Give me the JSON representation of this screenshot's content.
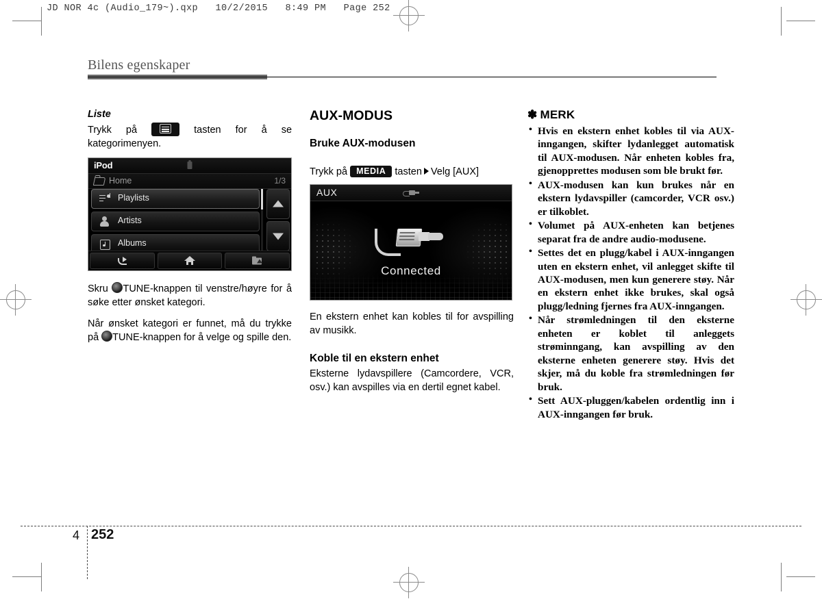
{
  "print_header": "JD NOR 4c (Audio_179~).qxp   10/2/2015   8:49 PM   Page 252",
  "page_title": "Bilens egenskaper",
  "footer": {
    "chapter": "4",
    "page": "252"
  },
  "left_column": {
    "heading": "Liste",
    "instruction_before": "Trykk på",
    "key_icon": "list-button-icon",
    "instruction_after": "tasten for å se kategorimenyen.",
    "device": {
      "title": "iPod",
      "battery_icon": "battery-icon",
      "breadcrumb": "Home",
      "page_indicator": "1/3",
      "items": [
        {
          "label": "Playlists",
          "icon": "playlist-icon",
          "selected": true
        },
        {
          "label": "Artists",
          "icon": "person-icon",
          "selected": false
        },
        {
          "label": "Albums",
          "icon": "album-icon",
          "selected": false
        }
      ],
      "scroll_up_icon": "arrow-up-icon",
      "scroll_down_icon": "arrow-down-icon",
      "bottom_buttons": [
        {
          "icon": "back-icon"
        },
        {
          "icon": "home-icon"
        },
        {
          "icon": "folder-up-icon"
        }
      ]
    },
    "para1_a": "Skru",
    "para1_b": "TUNE-knappen til venstre/høyre for å søke etter ønsket kategori.",
    "para2_a": "Når ønsket kategori er funnet, må du trykke på",
    "para2_b": "TUNE-knappen for å velge og spille den."
  },
  "middle_column": {
    "heading": "AUX-MODUS",
    "subheading": "Bruke AUX-modusen",
    "press_prefix": "Trykk på",
    "media_key": "MEDIA",
    "press_middle": "tasten",
    "press_suffix": "Velg [AUX]",
    "device": {
      "title": "AUX",
      "plug_icon": "aux-plug-icon",
      "status": "Connected"
    },
    "paragraph": "En ekstern enhet kan kobles til for avspilling av musikk.",
    "subheading2": "Koble til en ekstern enhet",
    "paragraph2": "Eksterne lydavspillere (Camcordere, VCR, osv.) kan avspilles via en dertil egnet kabel."
  },
  "note_column": {
    "star": "✽",
    "heading": "MERK",
    "items": [
      "Hvis en ekstern enhet kobles til via AUX-inngangen, skifter lydanlegget automatisk til AUX-modusen. Når enheten kobles fra, gjenopprettes modusen som ble brukt før.",
      "AUX-modusen kan kun brukes når en ekstern lydavspiller (camcorder, VCR osv.) er tilkoblet.",
      "Volumet på AUX-enheten kan betjenes separat fra de andre audio-modusene.",
      "Settes det en plugg/kabel i AUX-inngangen uten en ekstern enhet, vil anlegget skifte til AUX-modusen, men kun generere støy. Når en ekstern enhet ikke brukes, skal også plugg/ledning fjernes fra AUX-inngangen.",
      "Når strømledningen til den eksterne enheten er koblet til anleggets strøminngang, kan avspilling av den eksterne enheten generere støy. Hvis det skjer, må du koble fra strømledningen før bruk.",
      "Sett AUX-pluggen/kabelen ordentlig inn i AUX-inngangen før bruk."
    ]
  }
}
